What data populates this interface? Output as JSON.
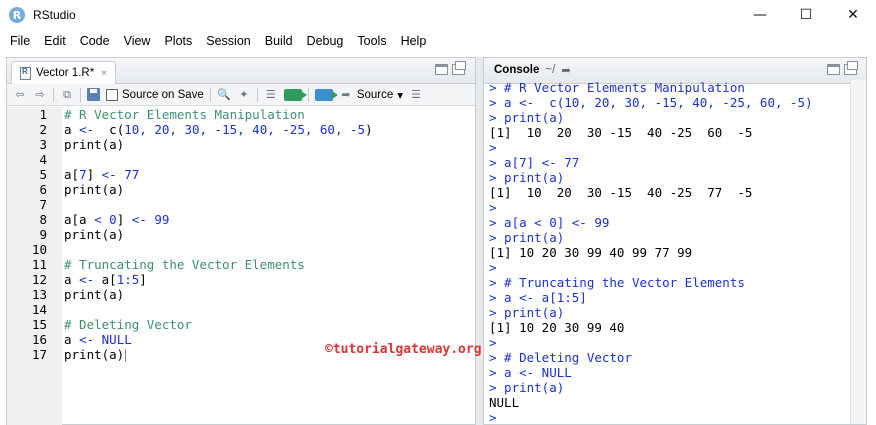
{
  "window": {
    "title": "RStudio",
    "minimize_glyph": "—",
    "maximize_glyph": "☐",
    "close_glyph": "✕"
  },
  "menu": [
    "File",
    "Edit",
    "Code",
    "View",
    "Plots",
    "Session",
    "Build",
    "Debug",
    "Tools",
    "Help"
  ],
  "editor": {
    "tab_label": "Vector 1.R*",
    "tab_close": "×",
    "source_on_save_label": "Source on Save",
    "source_label": "Source",
    "source_dropdown_glyph": "▾",
    "lines": [
      {
        "num": "1",
        "segments": [
          {
            "text": "# R Vector Elements Manipulation",
            "cls": "c-com"
          }
        ]
      },
      {
        "num": "2",
        "segments": [
          {
            "text": "a ",
            "cls": ""
          },
          {
            "text": "<-",
            "cls": "c-op"
          },
          {
            "text": "  c(",
            "cls": ""
          },
          {
            "text": "10, 20, 30, -15, 40, -25, 60, -5",
            "cls": "c-num"
          },
          {
            "text": ")",
            "cls": ""
          }
        ]
      },
      {
        "num": "3",
        "segments": [
          {
            "text": "print(a)",
            "cls": ""
          }
        ]
      },
      {
        "num": "4",
        "segments": []
      },
      {
        "num": "5",
        "segments": [
          {
            "text": "a[",
            "cls": ""
          },
          {
            "text": "7",
            "cls": "c-num"
          },
          {
            "text": "] ",
            "cls": ""
          },
          {
            "text": "<-",
            "cls": "c-op"
          },
          {
            "text": " ",
            "cls": ""
          },
          {
            "text": "77",
            "cls": "c-num"
          }
        ]
      },
      {
        "num": "6",
        "segments": [
          {
            "text": "print(a)",
            "cls": ""
          }
        ]
      },
      {
        "num": "7",
        "segments": []
      },
      {
        "num": "8",
        "segments": [
          {
            "text": "a[a ",
            "cls": ""
          },
          {
            "text": "<",
            "cls": "c-op"
          },
          {
            "text": " ",
            "cls": ""
          },
          {
            "text": "0",
            "cls": "c-num"
          },
          {
            "text": "] ",
            "cls": ""
          },
          {
            "text": "<-",
            "cls": "c-op"
          },
          {
            "text": " ",
            "cls": ""
          },
          {
            "text": "99",
            "cls": "c-num"
          }
        ]
      },
      {
        "num": "9",
        "segments": [
          {
            "text": "print(a)",
            "cls": ""
          }
        ]
      },
      {
        "num": "10",
        "segments": []
      },
      {
        "num": "11",
        "segments": [
          {
            "text": "# Truncating the Vector Elements",
            "cls": "c-com"
          }
        ]
      },
      {
        "num": "12",
        "segments": [
          {
            "text": "a ",
            "cls": ""
          },
          {
            "text": "<-",
            "cls": "c-op"
          },
          {
            "text": " a[",
            "cls": ""
          },
          {
            "text": "1:5",
            "cls": "c-num"
          },
          {
            "text": "]",
            "cls": ""
          }
        ]
      },
      {
        "num": "13",
        "segments": [
          {
            "text": "print(a)",
            "cls": ""
          }
        ]
      },
      {
        "num": "14",
        "segments": []
      },
      {
        "num": "15",
        "segments": [
          {
            "text": "# Deleting Vector",
            "cls": "c-com"
          }
        ]
      },
      {
        "num": "16",
        "segments": [
          {
            "text": "a ",
            "cls": ""
          },
          {
            "text": "<-",
            "cls": "c-op"
          },
          {
            "text": " ",
            "cls": ""
          },
          {
            "text": "NULL",
            "cls": "c-kw"
          }
        ]
      },
      {
        "num": "17",
        "segments": [
          {
            "text": "print(a)",
            "cls": ""
          }
        ]
      }
    ]
  },
  "console": {
    "title": "Console",
    "path": "~/",
    "lines": [
      {
        "text": "> # R Vector Elements Manipulation",
        "type": "input"
      },
      {
        "text": "> a <-  c(10, 20, 30, -15, 40, -25, 60, -5)",
        "type": "input"
      },
      {
        "text": "> print(a)",
        "type": "input"
      },
      {
        "text": "[1]  10  20  30 -15  40 -25  60  -5",
        "type": "output"
      },
      {
        "text": ">",
        "type": "input"
      },
      {
        "text": "> a[7] <- 77",
        "type": "input"
      },
      {
        "text": "> print(a)",
        "type": "input"
      },
      {
        "text": "[1]  10  20  30 -15  40 -25  77  -5",
        "type": "output"
      },
      {
        "text": ">",
        "type": "input"
      },
      {
        "text": "> a[a < 0] <- 99",
        "type": "input"
      },
      {
        "text": "> print(a)",
        "type": "input"
      },
      {
        "text": "[1] 10 20 30 99 40 99 77 99",
        "type": "output"
      },
      {
        "text": ">",
        "type": "input"
      },
      {
        "text": "> # Truncating the Vector Elements",
        "type": "input"
      },
      {
        "text": "> a <- a[1:5]",
        "type": "input"
      },
      {
        "text": "> print(a)",
        "type": "input"
      },
      {
        "text": "[1] 10 20 30 99 40",
        "type": "output"
      },
      {
        "text": ">",
        "type": "input"
      },
      {
        "text": "> # Deleting Vector",
        "type": "input"
      },
      {
        "text": "> a <- NULL",
        "type": "input"
      },
      {
        "text": "> print(a)",
        "type": "input"
      },
      {
        "text": "NULL",
        "type": "output"
      },
      {
        "text": ">",
        "type": "input"
      }
    ]
  },
  "watermark": "©tutorialgateway.org",
  "icons": {
    "app": "R",
    "back": "⇦",
    "forward": "⇨",
    "show_in_window": "⧉",
    "wand": "✦",
    "search": "🔍",
    "outline": "☰",
    "console_arrow": "➦"
  },
  "colors": {
    "comment": "#3f8f6a",
    "number": "#1c2fd1",
    "console_input": "#1c2fd1",
    "watermark": "#dd3333"
  }
}
